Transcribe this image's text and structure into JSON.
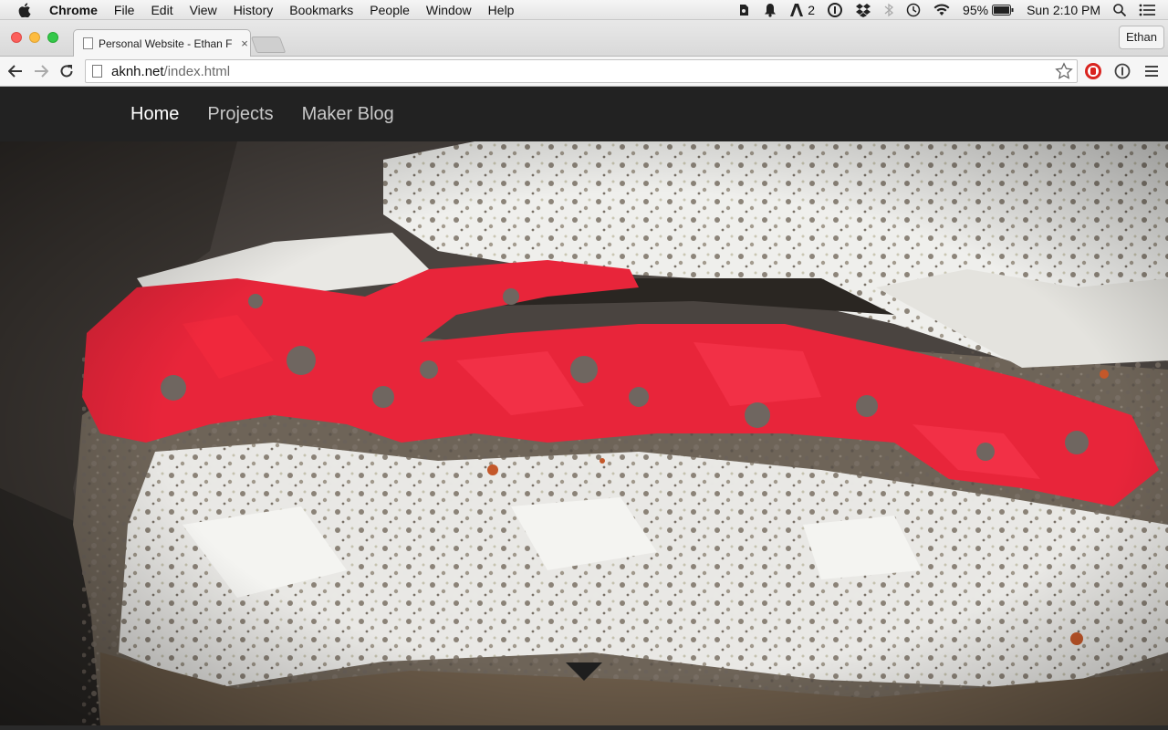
{
  "menubar": {
    "app_name": "Chrome",
    "menus": [
      "File",
      "Edit",
      "View",
      "History",
      "Bookmarks",
      "People",
      "Window",
      "Help"
    ],
    "adobe_count": "2",
    "battery": "95%",
    "clock": "Sun 2:10 PM"
  },
  "browser": {
    "tab_title": "Personal Website - Ethan F",
    "tab_close": "×",
    "profile_name": "Ethan",
    "url_host": "aknh.net",
    "url_path": "/index.html"
  },
  "site": {
    "nav": [
      {
        "label": "Home",
        "active": true
      },
      {
        "label": "Projects",
        "active": false
      },
      {
        "label": "Maker Blog",
        "active": false
      }
    ],
    "hero_image": "photo of rock with red and white paint",
    "scroll_icon": "triangle-down-icon"
  },
  "colors": {
    "nav_bg": "#222222",
    "nav_active": "#ffffff",
    "nav_inactive": "#c8c8c8",
    "paint_red": "#f0283c",
    "paint_white": "#f2f2f2"
  }
}
